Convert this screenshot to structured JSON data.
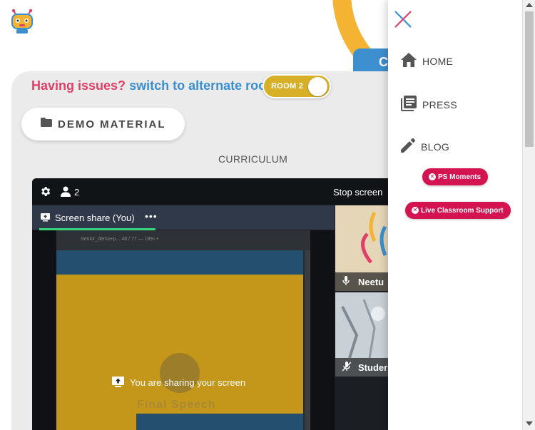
{
  "header": {
    "logo_icon": "robot-logo-icon",
    "blue_tab_text": "C"
  },
  "issues": {
    "question": "Having issues?",
    "switch_text": "switch to alternate room"
  },
  "room_toggle": {
    "label": "ROOM 2",
    "state": "on",
    "color": "#d8b028"
  },
  "demo_material": {
    "label": "DEMO MATERIAL",
    "icon": "folder-icon"
  },
  "curriculum_label": "CURRICULUM",
  "meeting": {
    "participant_count": "2",
    "stop_label": "Stop screen",
    "share_tab_label": "Screen share (You)",
    "share_tab_more": "•••",
    "doc_toolbar_text": "Senior_demo+p...   48 / 77   —  18%  +",
    "doc_slide_title": "Final Speech",
    "sharing_message": "You are sharing your screen",
    "tiles": [
      {
        "name": "Neetu",
        "mic": "mic-on-icon"
      },
      {
        "name": "Studer",
        "mic": "mic-off-icon"
      }
    ]
  },
  "side_menu": {
    "close_icon": "close-icon",
    "items": [
      {
        "label": "HOME",
        "icon": "home-icon"
      },
      {
        "label": "PRESS",
        "icon": "press-icon"
      },
      {
        "label": "BLOG",
        "icon": "pencil-icon"
      }
    ],
    "pills": [
      {
        "label": "PS Moments"
      },
      {
        "label": "Live Classroom Support"
      }
    ],
    "pill_color": "#d31450"
  },
  "colors": {
    "question": "#e03f68",
    "switch": "#3a8fcf",
    "share_line": "#37d67a"
  }
}
